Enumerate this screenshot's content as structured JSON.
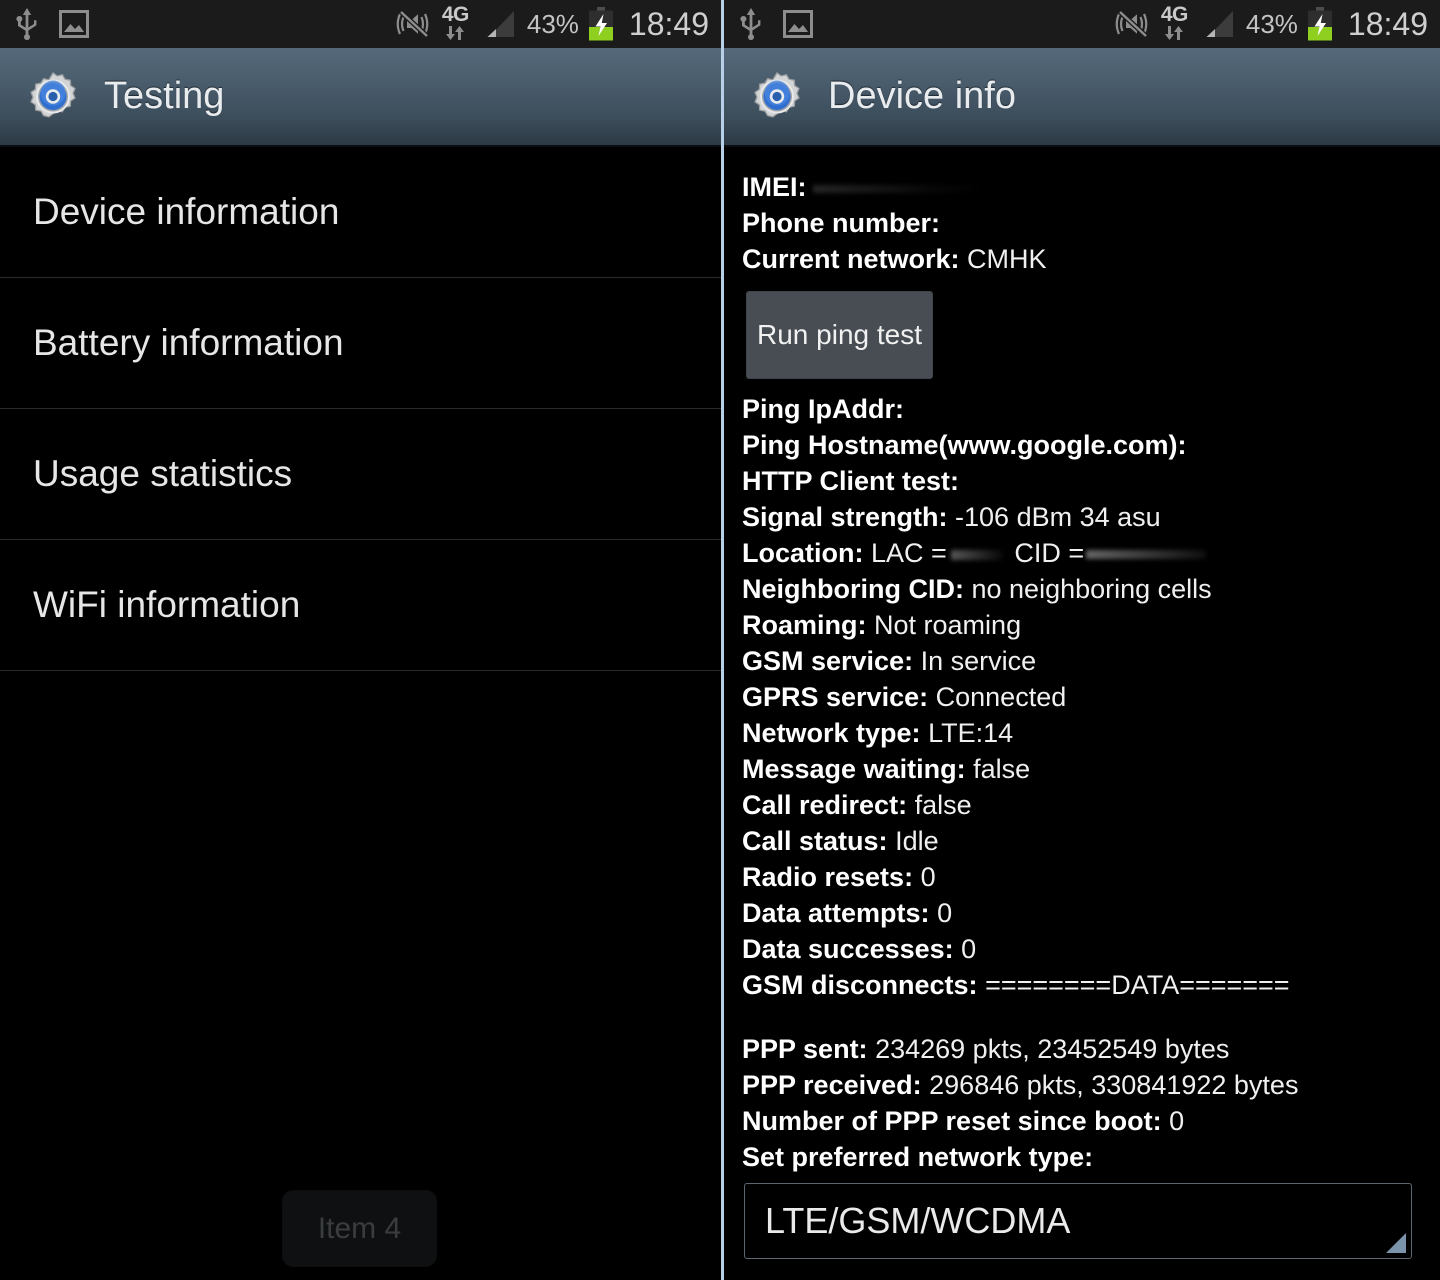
{
  "statusbar": {
    "icons": [
      "usb-icon",
      "screenshot-icon",
      "vibrate-mute-icon",
      "4g-data-icon",
      "signal-bars-icon",
      "battery-charging-icon"
    ],
    "network_label": "4G",
    "battery_percent": "43%",
    "clock": "18:49"
  },
  "left": {
    "title": "Testing",
    "app_icon": "settings-gear-icon",
    "items": [
      {
        "label": "Device information"
      },
      {
        "label": "Battery information"
      },
      {
        "label": "Usage statistics"
      },
      {
        "label": "WiFi information"
      }
    ],
    "toast": {
      "label": "Item 4"
    }
  },
  "right": {
    "title": "Device info",
    "app_icon": "settings-gear-icon",
    "fields": [
      {
        "key": "IMEI:",
        "value": ""
      },
      {
        "key": "Phone number:",
        "value": ""
      },
      {
        "key": "Current network:",
        "value": "CMHK"
      }
    ],
    "ping_button": {
      "label": "Run ping test"
    },
    "results": [
      {
        "key": "Ping IpAddr:",
        "value": ""
      },
      {
        "key": "Ping Hostname(www.google.com):",
        "value": ""
      },
      {
        "key": "HTTP Client test:",
        "value": ""
      },
      {
        "key": "Signal strength:",
        "value": "-106 dBm   34 asu"
      },
      {
        "key": "Location:",
        "value": "LAC ="
      },
      {
        "key": "Neighboring CID:",
        "value": "no neighboring cells"
      },
      {
        "key": "Roaming:",
        "value": "Not roaming"
      },
      {
        "key": "GSM service:",
        "value": "In service"
      },
      {
        "key": "GPRS service:",
        "value": "Connected"
      },
      {
        "key": "Network type:",
        "value": "LTE:14"
      },
      {
        "key": "Message waiting:",
        "value": "false"
      },
      {
        "key": "Call redirect:",
        "value": "false"
      },
      {
        "key": "Call status:",
        "value": "Idle"
      },
      {
        "key": "Radio resets:",
        "value": "0"
      },
      {
        "key": "Data attempts:",
        "value": "0"
      },
      {
        "key": "Data successes:",
        "value": "0"
      },
      {
        "key": "GSM disconnects:",
        "value": "========DATA======="
      }
    ],
    "location_cid_label": "CID =",
    "ppp": [
      {
        "key": "PPP sent:",
        "value": "234269 pkts, 23452549 bytes"
      },
      {
        "key": "PPP received:",
        "value": "296846 pkts, 330841922 bytes"
      },
      {
        "key": "Number of PPP reset since boot:",
        "value": "0"
      }
    ],
    "preferred_network": {
      "label": "Set preferred network type:",
      "selected": "LTE/GSM/WCDMA"
    }
  },
  "colors": {
    "accent_blue": "#2f6fd0",
    "actionbar_top": "#55697a",
    "actionbar_bottom": "#2d3a45",
    "battery_green": "#8fcf1f",
    "divider": "#b8cfe8"
  }
}
